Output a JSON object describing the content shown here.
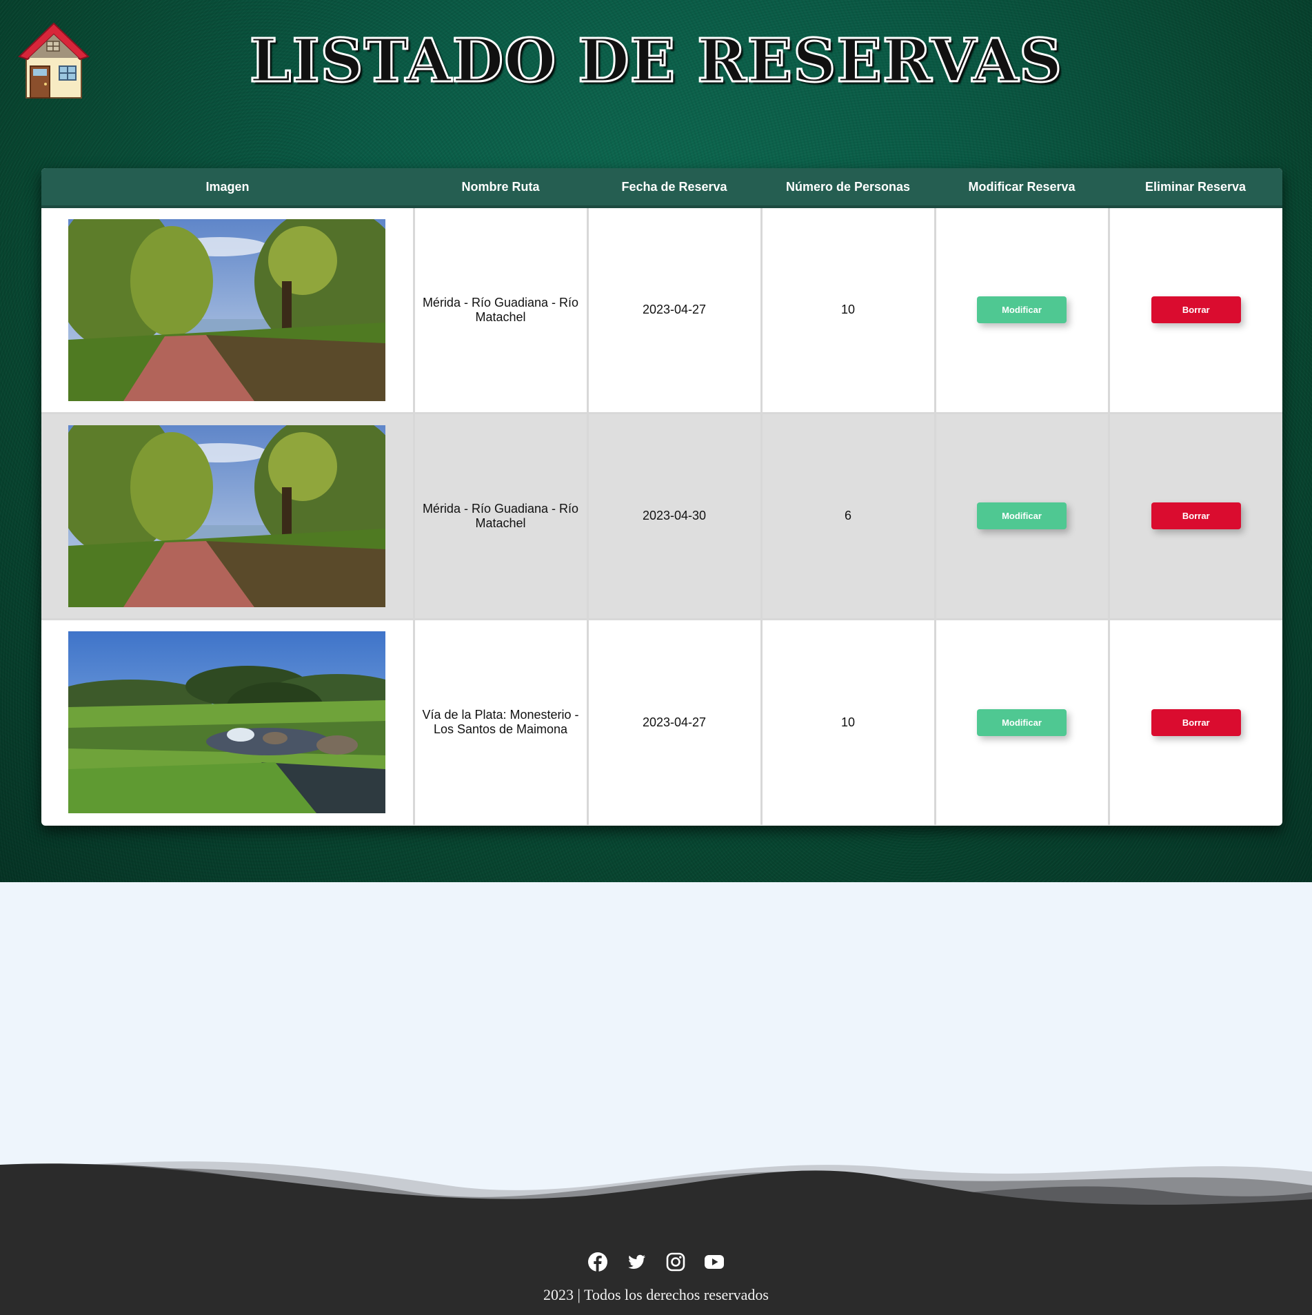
{
  "header": {
    "title": "LISTADO DE RESERVAS",
    "home_icon": "house-icon"
  },
  "table": {
    "columns": [
      "Imagen",
      "Nombre Ruta",
      "Fecha de Reserva",
      "Número de Personas",
      "Modificar Reserva",
      "Eliminar Reserva"
    ],
    "rows": [
      {
        "image": "river-path-photo",
        "route": "Mérida - Río Guadiana - Río Matachel",
        "date": "2023-04-27",
        "people": "10",
        "modify_label": "Modificar",
        "delete_label": "Borrar"
      },
      {
        "image": "river-path-photo",
        "route": "Mérida - Río Guadiana - Río Matachel",
        "date": "2023-04-30",
        "people": "6",
        "modify_label": "Modificar",
        "delete_label": "Borrar"
      },
      {
        "image": "stream-meadow-photo",
        "route": "Vía de la Plata: Monesterio - Los Santos de Maimona",
        "date": "2023-04-27",
        "people": "10",
        "modify_label": "Modificar",
        "delete_label": "Borrar"
      }
    ]
  },
  "footer": {
    "social_icons": [
      "facebook-icon",
      "twitter-icon",
      "instagram-icon",
      "youtube-icon"
    ],
    "copyright": "2023 | Todos los derechos reservados"
  },
  "colors": {
    "header_row": "#255e51",
    "modify_button": "#4fc892",
    "delete_button": "#da0c2f",
    "footer": "#2b2b2b",
    "page_background": "#eef5fc"
  }
}
